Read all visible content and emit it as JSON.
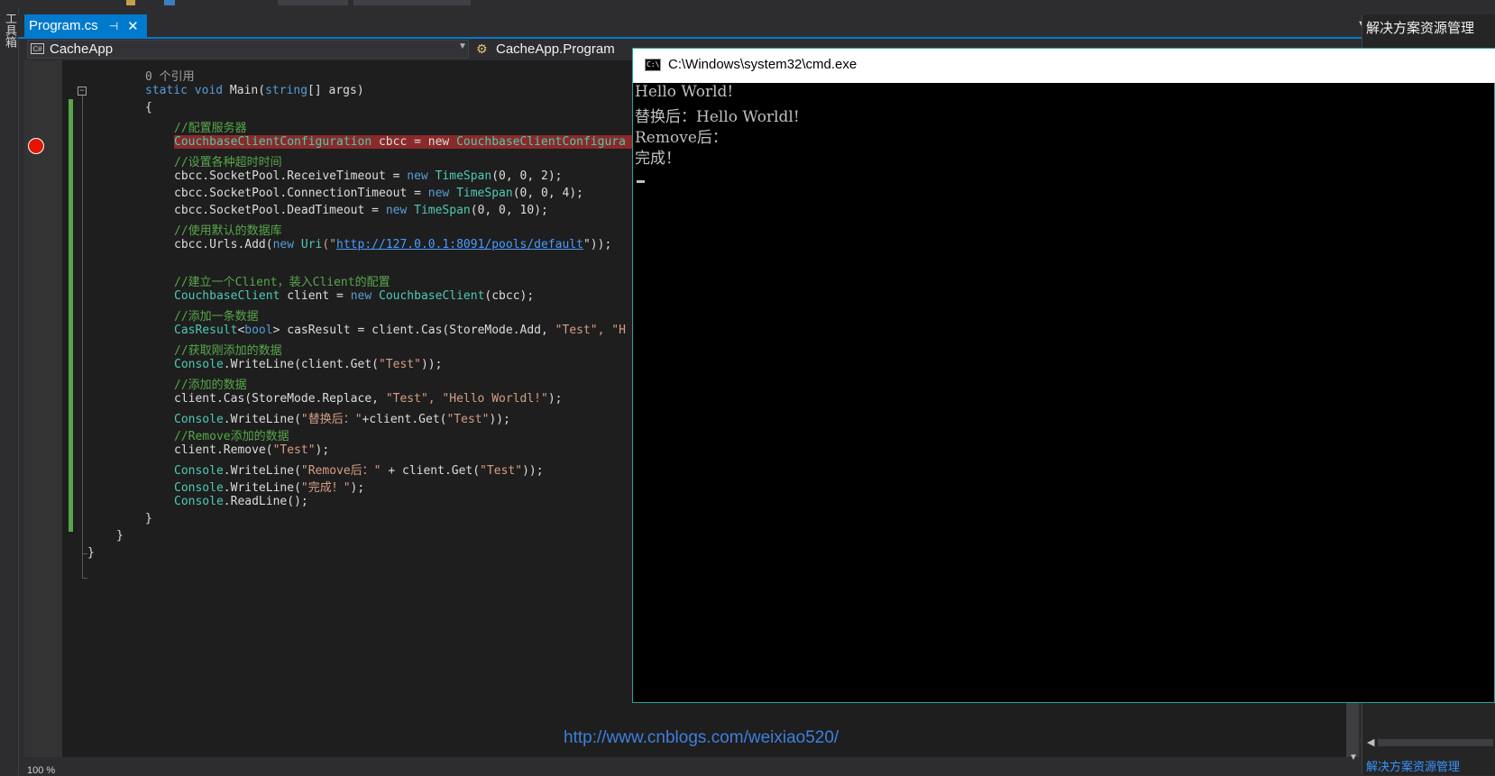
{
  "sidebar": {
    "toolbox_label": "工具箱"
  },
  "tab": {
    "title": "Program.cs",
    "pin": "⊣",
    "close": "✕"
  },
  "nav": {
    "project": "CacheApp",
    "project_icon": "C#",
    "class": "CacheApp.Program"
  },
  "solution_explorer": {
    "header": "解决方案资源管理",
    "bottom_tab": "解决方案资源管理"
  },
  "editor": {
    "zoom": "100 %",
    "code": {
      "l1": "0 个引用",
      "l2a": "static void ",
      "l2b": "Main(",
      "l2c": "string",
      "l2d": "[] args)",
      "l3": "{",
      "l4": "//配置服务器",
      "l5a": "CouchbaseClientConfiguration",
      "l5b": " cbcc = ",
      "l5c": "new ",
      "l5d": "CouchbaseClientConfigura",
      "l6": "//设置各种超时时间",
      "l7a": "cbcc.SocketPool.ReceiveTimeout = ",
      "l7b": "new ",
      "l7c": "TimeSpan",
      "l7d": "(0, 0, 2);",
      "l8a": "cbcc.SocketPool.ConnectionTimeout = ",
      "l8b": "new ",
      "l8c": "TimeSpan",
      "l8d": "(0, 0, 4);",
      "l9a": "cbcc.SocketPool.DeadTimeout = ",
      "l9b": "new ",
      "l9c": "TimeSpan",
      "l9d": "(0, 0, 10);",
      "l10": "//使用默认的数据库",
      "l11a": "cbcc.Urls.Add(",
      "l11b": "new ",
      "l11c": "Uri",
      "l11d": "(\"",
      "l11e": "http://127.0.0.1:8091/pools/default",
      "l11f": "\"));",
      "l12": "//建立一个Client，装入Client的配置",
      "l13a": "CouchbaseClient",
      "l13b": " client = ",
      "l13c": "new ",
      "l13d": "CouchbaseClient",
      "l13e": "(cbcc);",
      "l14": "//添加一条数据",
      "l15a": "CasResult",
      "l15b": "<",
      "l15c": "bool",
      "l15d": "> casResult = client.Cas(StoreMode.Add, ",
      "l15e": "\"Test\", \"H",
      "l16": "//获取刚添加的数据",
      "l17a": "Console",
      "l17b": ".WriteLine(client.Get(",
      "l17c": "\"Test\"",
      "l17d": "));",
      "l18": "//添加的数据",
      "l19a": "client.Cas(StoreMode.Replace, ",
      "l19b": "\"Test\", \"Hello Worldl!\"",
      "l19c": ");",
      "l20a": "Console",
      "l20b": ".WriteLine(",
      "l20c": "\"替换后：\"",
      "l20d": "+client.Get(",
      "l20e": "\"Test\"",
      "l20f": "));",
      "l21": "//Remove添加的数据",
      "l22a": "client.Remove(",
      "l22b": "\"Test\"",
      "l22c": ");",
      "l23a": "Console",
      "l23b": ".WriteLine(",
      "l23c": "\"Remove后：\"",
      "l23d": " + client.Get(",
      "l23e": "\"Test\"",
      "l23f": "));",
      "l24a": "Console",
      "l24b": ".WriteLine(",
      "l24c": "\"完成！\"",
      "l24d": ");",
      "l25a": "Console",
      "l25b": ".ReadLine();",
      "l26": "}",
      "l27": "}",
      "l28": "}"
    }
  },
  "cmd": {
    "title": "C:\\Windows\\system32\\cmd.exe",
    "icon_text": "C:\\",
    "lines": [
      "Hello World!",
      "替换后：Hello Worldl!",
      "Remove后：",
      "完成！"
    ]
  },
  "watermark": "http://www.cnblogs.com/weixiao520/",
  "colors": {
    "accent": "#007acc",
    "breakpoint": "#e51400",
    "keyword": "#569cd6",
    "type": "#4ec9b0",
    "comment": "#57a64a",
    "string": "#d69d85"
  }
}
